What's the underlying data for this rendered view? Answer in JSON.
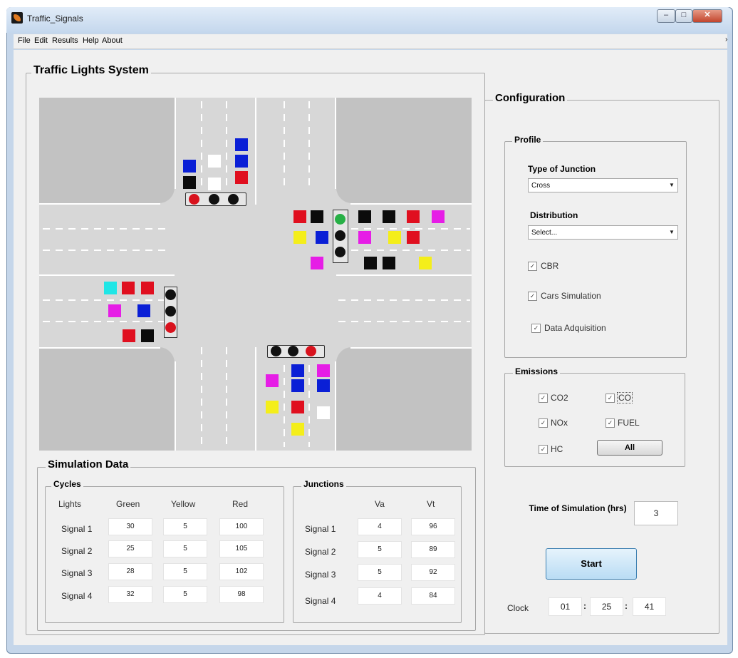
{
  "window": {
    "title": "Traffic_Signals"
  },
  "menu": [
    "File",
    "Edit",
    "Results",
    "Help",
    "About"
  ],
  "main_panel": {
    "title": "Traffic Lights System"
  },
  "config": {
    "title": "Configuration",
    "profile": {
      "title": "Profile",
      "junction_label": "Type of Junction",
      "junction_value": "Cross",
      "distribution_label": "Distribution",
      "distribution_value": "Select...",
      "checks": [
        {
          "label": "CBR",
          "checked": true
        },
        {
          "label": "Cars Simulation",
          "checked": true
        },
        {
          "label": "Data Adquisition",
          "checked": true
        }
      ]
    },
    "emissions": {
      "title": "Emissions",
      "checks": [
        {
          "label": "CO2",
          "checked": true
        },
        {
          "label": "CO",
          "checked": true
        },
        {
          "label": "NOx",
          "checked": true
        },
        {
          "label": "FUEL",
          "checked": true
        },
        {
          "label": "HC",
          "checked": true
        }
      ],
      "all_button": "All"
    },
    "time_label": "Time of Simulation (hrs)",
    "time_value": "3",
    "start_button": "Start",
    "clock_label": "Clock",
    "clock": {
      "h": "01",
      "m": "25",
      "s": "41",
      "sep": ":"
    }
  },
  "sim": {
    "title": "Simulation Data",
    "cycles": {
      "title": "Cycles",
      "headers": [
        "Lights",
        "Green",
        "Yellow",
        "Red"
      ],
      "rows": [
        {
          "name": "Signal 1",
          "green": "30",
          "yellow": "5",
          "red": "100"
        },
        {
          "name": "Signal 2",
          "green": "25",
          "yellow": "5",
          "red": "105"
        },
        {
          "name": "Signal 3",
          "green": "28",
          "yellow": "5",
          "red": "102"
        },
        {
          "name": "Signal 4",
          "green": "32",
          "yellow": "5",
          "red": "98"
        }
      ]
    },
    "junctions": {
      "title": "Junctions",
      "headers": [
        "Va",
        "Vt"
      ],
      "rows": [
        {
          "name": "Signal 1",
          "va": "4",
          "vt": "96"
        },
        {
          "name": "Signal 2",
          "va": "5",
          "vt": "89"
        },
        {
          "name": "Signal 3",
          "va": "5",
          "vt": "92"
        },
        {
          "name": "Signal 4",
          "va": "4",
          "vt": "84"
        }
      ]
    }
  },
  "colors": {
    "red": "#e00f1f",
    "blue": "#0a1fd6",
    "black": "#0b0b0b",
    "white": "#ffffff",
    "yellow": "#f4ee1a",
    "magenta": "#e61de6",
    "cyan": "#1fe6e6",
    "lamp_red": "#d8121d",
    "lamp_green": "#27b046",
    "lamp_off": "#111111"
  },
  "intersection": {
    "signals": [
      {
        "name": "north",
        "state": [
          "red",
          "off",
          "off"
        ]
      },
      {
        "name": "east",
        "state": [
          "green",
          "off",
          "off"
        ]
      },
      {
        "name": "west",
        "state": [
          "off",
          "off",
          "red"
        ]
      },
      {
        "name": "south",
        "state": [
          "off",
          "off",
          "red"
        ]
      }
    ]
  }
}
